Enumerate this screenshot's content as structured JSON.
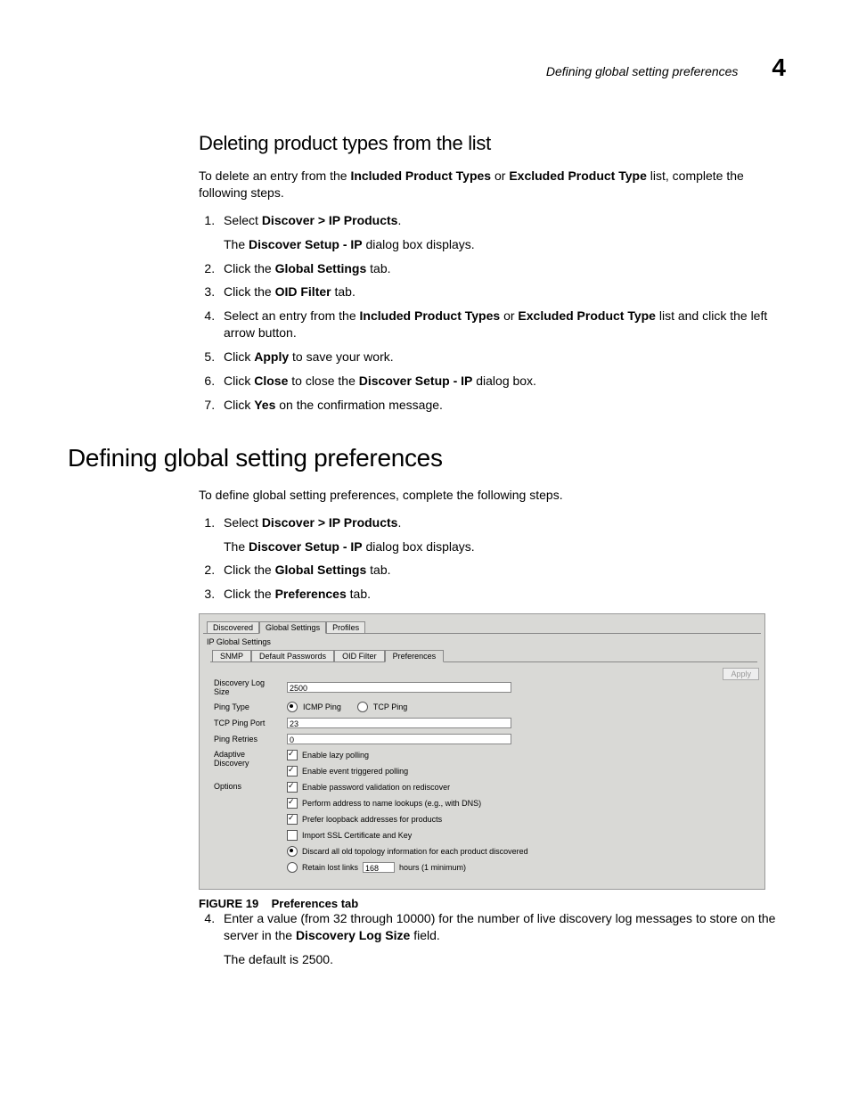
{
  "header": {
    "title": "Defining global setting preferences",
    "chapter": "4"
  },
  "section1": {
    "heading": "Deleting product types from the list",
    "intro_pre": "To delete an entry from the ",
    "intro_bold1": "Included Product Types",
    "intro_mid": " or ",
    "intro_bold2": "Excluded Product Type",
    "intro_post": " list, complete the following steps.",
    "steps": {
      "s1_a": "Select ",
      "s1_b": "Discover > IP Products",
      "s1_c": ".",
      "s1_sub_a": "The ",
      "s1_sub_b": "Discover Setup - IP",
      "s1_sub_c": " dialog box displays.",
      "s2_a": "Click the ",
      "s2_b": "Global Settings",
      "s2_c": " tab.",
      "s3_a": "Click the ",
      "s3_b": "OID Filter",
      "s3_c": " tab.",
      "s4_a": "Select an entry from the ",
      "s4_b": "Included Product Types",
      "s4_c": " or ",
      "s4_d": "Excluded Product Type",
      "s4_e": " list and click the left arrow button.",
      "s5_a": "Click ",
      "s5_b": "Apply",
      "s5_c": " to save your work.",
      "s6_a": "Click ",
      "s6_b": "Close",
      "s6_c": " to close the ",
      "s6_d": "Discover Setup - IP",
      "s6_e": " dialog box.",
      "s7_a": "Click ",
      "s7_b": "Yes",
      "s7_c": " on the confirmation message."
    }
  },
  "section2": {
    "heading": "Defining global setting preferences",
    "intro": "To define global setting preferences, complete the following steps.",
    "steps": {
      "s1_a": "Select ",
      "s1_b": "Discover > IP Products",
      "s1_c": ".",
      "s1_sub_a": "The ",
      "s1_sub_b": "Discover Setup - IP",
      "s1_sub_c": " dialog box displays.",
      "s2_a": "Click the ",
      "s2_b": "Global Settings",
      "s2_c": " tab.",
      "s3_a": "Click the ",
      "s3_b": "Preferences",
      "s3_c": " tab.",
      "s4_a": "Enter a value (from 32 through 10000) for the number of live discovery log messages to store on the server in the ",
      "s4_b": "Discovery Log Size",
      "s4_c": " field.",
      "s4_sub": "The default is 2500."
    }
  },
  "figure": {
    "caption_label": "FIGURE 19",
    "caption_text": "Preferences tab",
    "tabs": {
      "t1": "Discovered",
      "t2": "Global Settings",
      "t3": "Profiles"
    },
    "panel_title": "IP Global Settings",
    "inner_tabs": {
      "t1": "SNMP",
      "t2": "Default Passwords",
      "t3": "OID Filter",
      "t4": "Preferences"
    },
    "apply": "Apply",
    "labels": {
      "log_size": "Discovery Log Size",
      "ping_type": "Ping Type",
      "tcp_port": "TCP Ping Port",
      "ping_retries": "Ping Retries",
      "adaptive": "Adaptive Discovery",
      "options": "Options"
    },
    "values": {
      "log_size": "2500",
      "tcp_port": "23",
      "ping_retries": "0",
      "retain_hours": "168"
    },
    "radios_ping": {
      "icmp": "ICMP Ping",
      "tcp": "TCP Ping"
    },
    "checks": {
      "lazy": "Enable lazy polling",
      "event": "Enable event triggered polling",
      "pwd": "Enable password validation on rediscover",
      "dns": "Perform address to name lookups (e.g., with DNS)",
      "loopback": "Prefer loopback addresses for products",
      "ssl": "Import SSL Certificate and Key"
    },
    "radios_topo": {
      "discard": "Discard all old topology information for each product discovered",
      "retain_pre": "Retain lost links",
      "retain_post": "hours (1 minimum)"
    }
  }
}
